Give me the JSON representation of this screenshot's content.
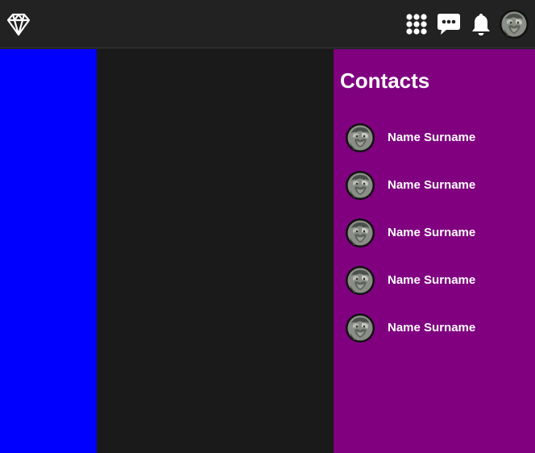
{
  "colors": {
    "topbar": "#222222",
    "left_sidebar": "#0000ff",
    "center_feed": "#1a1a1a",
    "right_panel": "#800080",
    "icon": "#ffffff"
  },
  "topbar": {
    "logo_icon": "diamond-icon",
    "icons": [
      "apps-grid-icon",
      "chat-bubble-icon",
      "bell-icon"
    ],
    "avatar": "user-avatar"
  },
  "contacts": {
    "title": "Contacts",
    "items": [
      {
        "name": "Name Surname"
      },
      {
        "name": "Name Surname"
      },
      {
        "name": "Name Surname"
      },
      {
        "name": "Name Surname"
      },
      {
        "name": "Name Surname"
      }
    ]
  }
}
